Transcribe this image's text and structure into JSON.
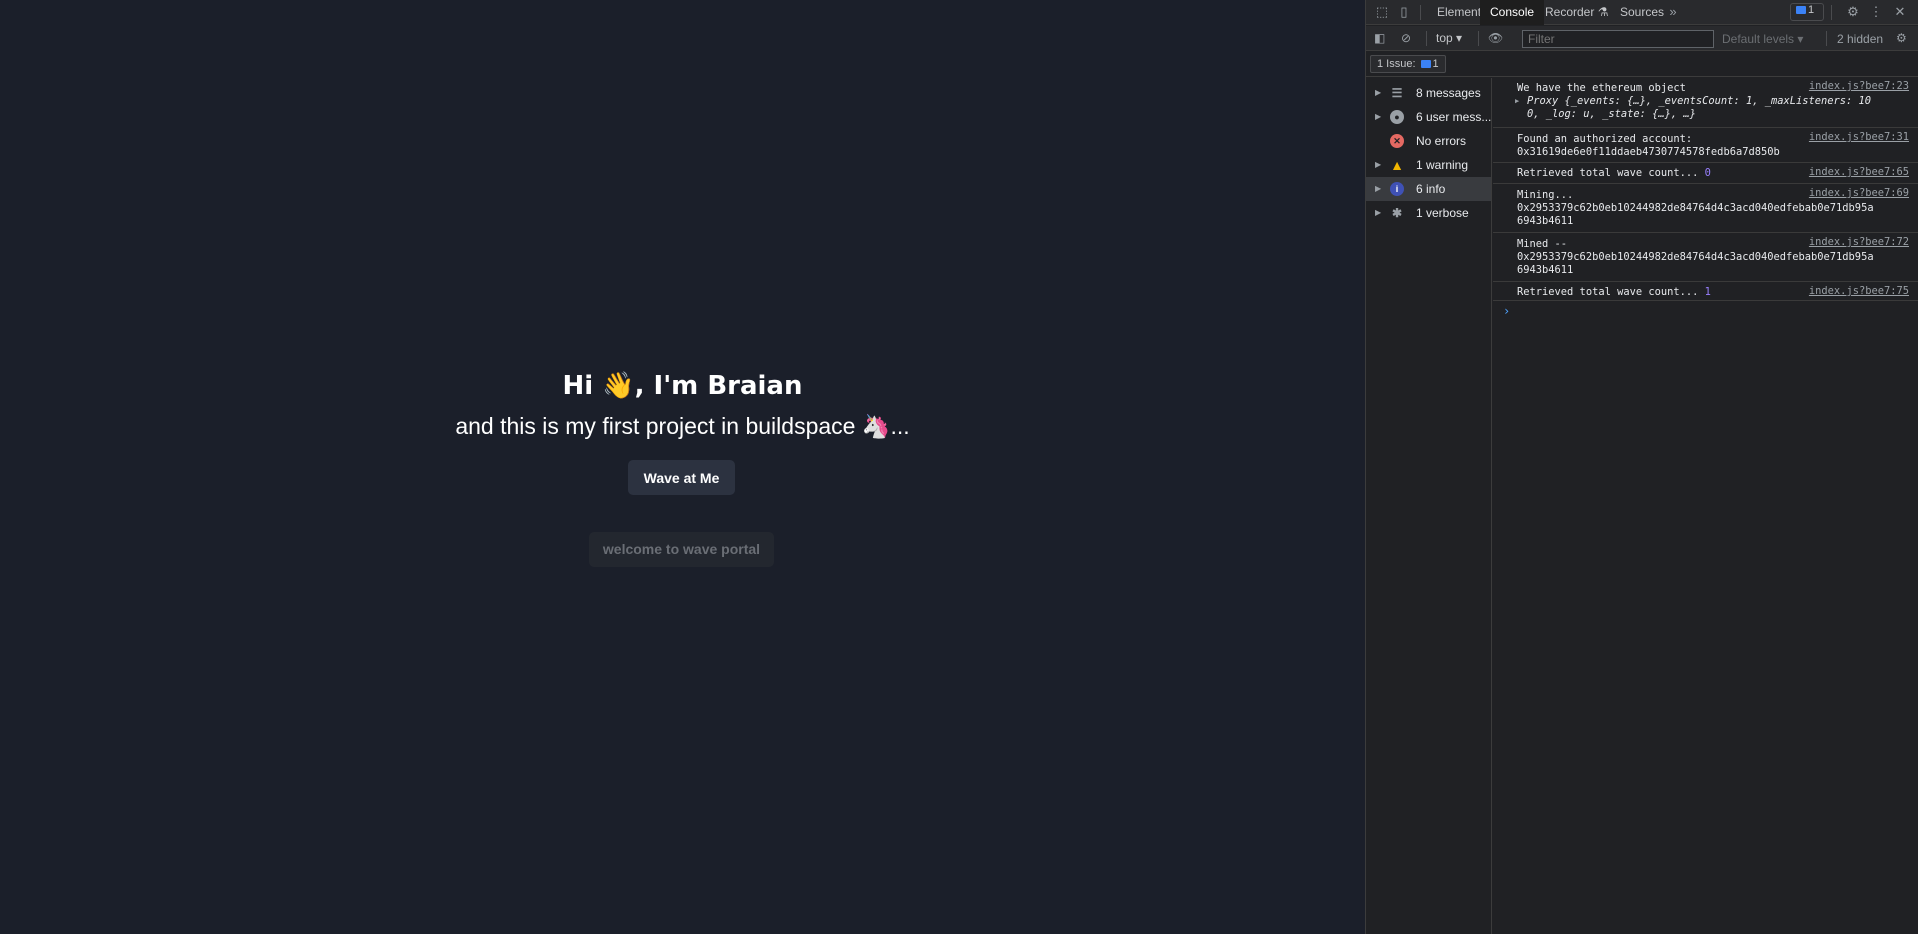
{
  "page": {
    "title": "Hi 👋, I'm Braian",
    "subtitle": "and this is my first project in buildspace 🦄...",
    "wave_button": "Wave at Me",
    "welcome_text": "welcome to wave portal"
  },
  "devtools": {
    "tabs": [
      "Elements",
      "Console",
      "Recorder",
      "Sources"
    ],
    "active_tab": "Console",
    "issues_badge_count": "1",
    "context": "top",
    "filter_placeholder": "Filter",
    "levels": "Default levels",
    "hidden": "2 hidden",
    "issues_chip": "1 Issue:",
    "issues_chip_count": "1",
    "sidebar": [
      {
        "label": "8 messages",
        "icon": "list-icon"
      },
      {
        "label": "6 user mess...",
        "icon": "user-icon"
      },
      {
        "label": "No errors",
        "icon": "error-icon"
      },
      {
        "label": "1 warning",
        "icon": "warning-icon"
      },
      {
        "label": "6 info",
        "icon": "info-icon"
      },
      {
        "label": "1 verbose",
        "icon": "bug-icon"
      }
    ],
    "logs": [
      {
        "line1": "We have the ethereum object",
        "line2": "Proxy {_events: {…}, _eventsCount: 1, _maxListeners: 10",
        "line3": "0, _log: u, _state: {…}, …}",
        "src": "index.js?bee7:23"
      },
      {
        "line1": "Found an authorized account:",
        "line2": "0x31619de6e0f11ddaeb4730774578fedb6a7d850b",
        "src": "index.js?bee7:31"
      },
      {
        "line1": "Retrieved total wave count... ",
        "value": "0",
        "src": "index.js?bee7:65"
      },
      {
        "line1": "Mining...",
        "line2": "0x2953379c62b0eb10244982de84764d4c3acd040edfebab0e71db95a",
        "line3": "6943b4611",
        "src": "index.js?bee7:69"
      },
      {
        "line1": "Mined --",
        "line2": "0x2953379c62b0eb10244982de84764d4c3acd040edfebab0e71db95a",
        "line3": "6943b4611",
        "src": "index.js?bee7:72"
      },
      {
        "line1": "Retrieved total wave count... ",
        "value": "1",
        "src": "index.js?bee7:75"
      }
    ]
  }
}
